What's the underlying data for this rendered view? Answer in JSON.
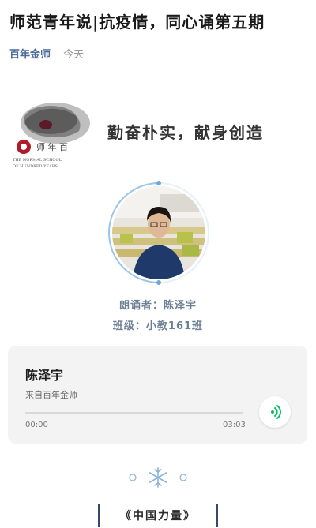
{
  "article": {
    "title": "师范青年说|抗疫情，同心诵第五期",
    "account": "百年金师",
    "date": "今天"
  },
  "banner": {
    "slogan": "勤奋朴实，献身创造",
    "logo_text": "THE NORMAL SCHOOL OF HUNDRED YEARS"
  },
  "reader": {
    "reader_line": "朗诵者：陈泽宇",
    "class_line": "班级：小教161班"
  },
  "audio": {
    "title": "陈泽宇",
    "source": "来自百年金师",
    "current_time": "00:00",
    "duration": "03:03",
    "progress": 0,
    "accent_color": "#07c160"
  },
  "section": {
    "label": "《中国力量》"
  }
}
